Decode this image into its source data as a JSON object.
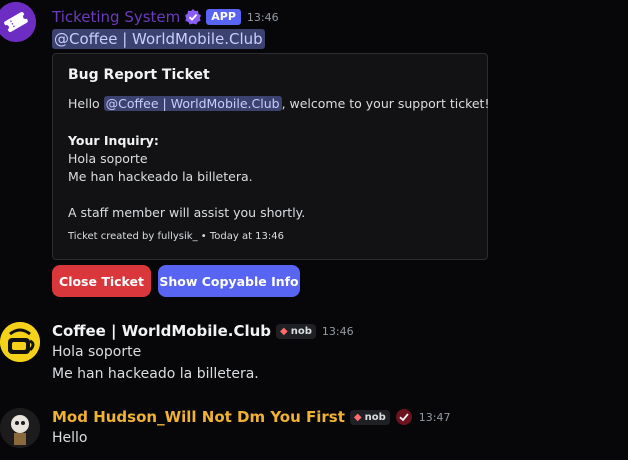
{
  "messages": [
    {
      "author": "Ticketing System",
      "badge": "APP",
      "time": "13:46",
      "mention": "@Coffee | WorldMobile.Club",
      "embed": {
        "title": "Bug Report Ticket",
        "hello": "Hello",
        "mention": "@Coffee | WorldMobile.Club",
        "welcome": ", welcome to your support ticket!",
        "inquiry_label": "Your Inquiry:",
        "inquiry_lines": [
          "Hola soporte",
          "Me han hackeado la billetera."
        ],
        "staff_note": "A staff member will assist you shortly.",
        "footer": "Ticket created by fullysik_ • Today at 13:46"
      },
      "buttons": {
        "close": "Close Ticket",
        "copy": "Show Copyable Info"
      }
    },
    {
      "author": "Coffee | WorldMobile.Club",
      "tag": "nob",
      "time": "13:46",
      "lines": [
        "Hola soporte",
        "Me han hackeado la billetera."
      ]
    },
    {
      "author": "Mod Hudson_Will Not Dm You First",
      "tag": "nob",
      "time": "13:47",
      "lines": [
        "Hello"
      ]
    }
  ],
  "colors": {
    "background": "#070709",
    "button_red": "#da373c",
    "button_blurple": "#5865f2",
    "mod_name": "#f0b232",
    "app_name": "#6b3bbb"
  },
  "icons": [
    "ticket-icon",
    "verified-icon",
    "cup-icon",
    "shield-tag-icon",
    "role-check-icon"
  ]
}
